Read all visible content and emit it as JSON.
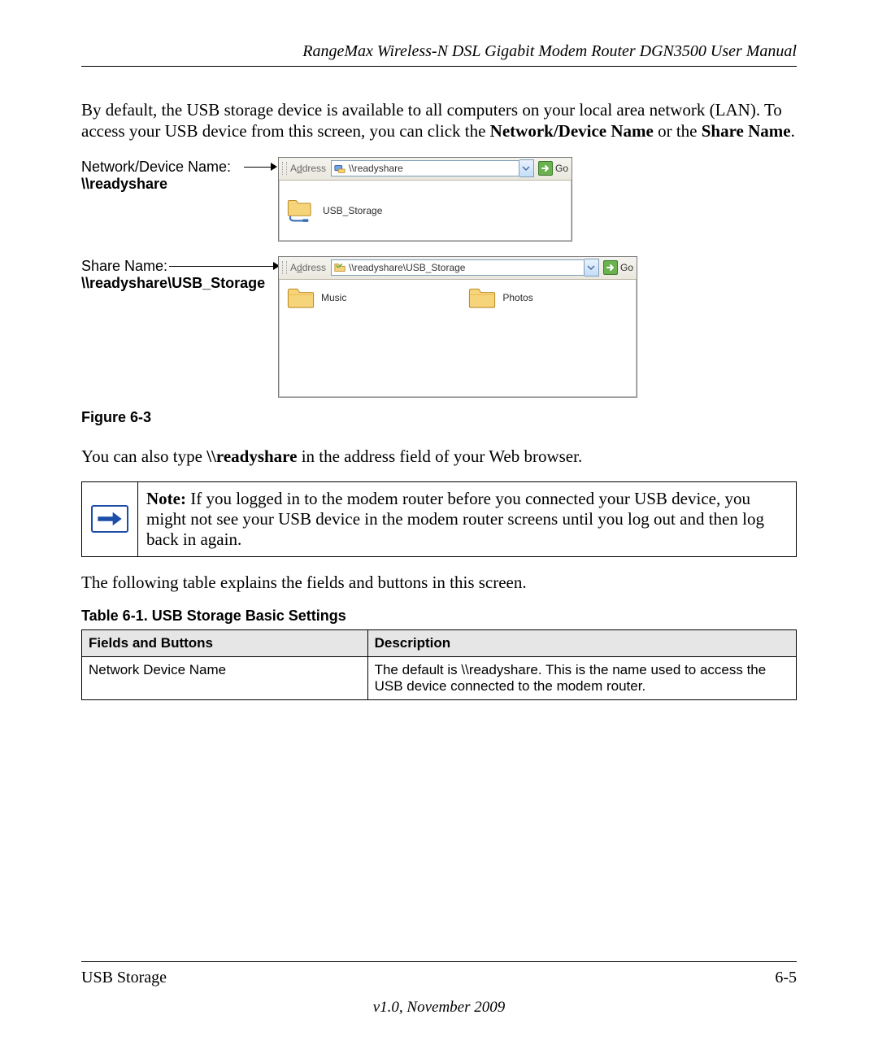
{
  "header_title": "RangeMax Wireless-N DSL Gigabit Modem Router DGN3500 User Manual",
  "para1_a": "By default, the USB storage device is available to all computers on your local area network (LAN). To access your USB device from this screen, you can click the ",
  "para1_bold1": "Network/Device Name",
  "para1_b": " or the ",
  "para1_bold2": "Share Name",
  "para1_c": ".",
  "labels": {
    "network_device_title": "Network/Device Name:",
    "network_device_value": "\\\\readyshare",
    "share_name_title": "Share Name:",
    "share_name_value": "\\\\readyshare\\USB_Storage"
  },
  "explorer1": {
    "address_label_pre": "A",
    "address_label_u": "d",
    "address_label_post": "dress",
    "address_value": "\\\\readyshare",
    "go_label": "Go",
    "icon_kind": "net-folder",
    "items": [
      {
        "name": "USB_Storage",
        "icon": "net-folder"
      }
    ]
  },
  "explorer2": {
    "address_label_pre": "A",
    "address_label_u": "d",
    "address_label_post": "dress",
    "address_value": "\\\\readyshare\\USB_Storage",
    "go_label": "Go",
    "items": [
      {
        "name": "Music",
        "icon": "folder"
      },
      {
        "name": "Photos",
        "icon": "folder"
      }
    ]
  },
  "figure_caption": "Figure 6-3",
  "para2_a": "You can also type ",
  "para2_bold": "\\\\readyshare",
  "para2_b": " in the address field of your Web browser.",
  "note": {
    "bold": "Note:",
    "text": " If you logged in to the modem router before you connected your USB device, you might not see your USB device in the modem router screens until you log out and then log back in again."
  },
  "para3": "The following table explains the fields and buttons in this screen.",
  "table_caption": "Table 6-1.  USB Storage Basic Settings",
  "table": {
    "head": {
      "c1": "Fields and Buttons",
      "c2": "Description"
    },
    "rows": [
      {
        "c1": "Network Device Name",
        "c2": "The default is \\\\readyshare. This is the name used to access the USB device connected to the modem router."
      }
    ]
  },
  "footer": {
    "section": "USB Storage",
    "page": "6-5",
    "version": "v1.0, November 2009"
  },
  "colors": {
    "folder_fill": "#f6d47a",
    "folder_stroke": "#bd8c2a",
    "go_green": "#6ab150",
    "note_blue": "#1b4ea8"
  }
}
